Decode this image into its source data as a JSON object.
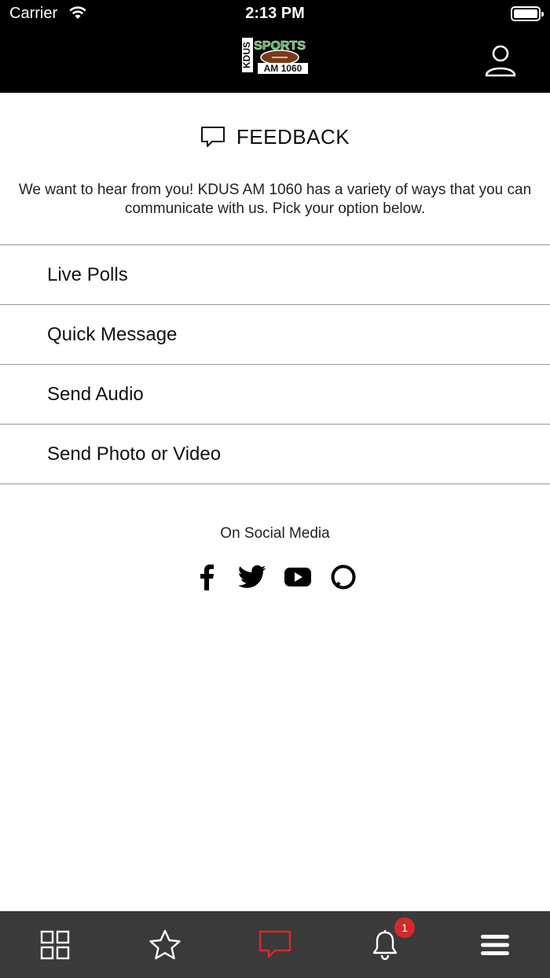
{
  "status_bar": {
    "carrier": "Carrier",
    "time": "2:13 PM"
  },
  "header": {
    "logo": {
      "line1": "KDUS",
      "line2": "SPORTS",
      "line3": "AM 1060"
    }
  },
  "feedback": {
    "title": "FEEDBACK",
    "intro": "We want to hear from you! KDUS AM 1060 has a variety of ways that you can communicate with us. Pick your option below."
  },
  "options": [
    {
      "label": "Live Polls"
    },
    {
      "label": "Quick Message"
    },
    {
      "label": "Send Audio"
    },
    {
      "label": "Send Photo or Video"
    }
  ],
  "social": {
    "label": "On Social Media",
    "icons": [
      "facebook-icon",
      "twitter-icon",
      "youtube-icon",
      "alexa-icon"
    ]
  },
  "tabbar": {
    "tabs": [
      "grid-icon",
      "star-icon",
      "chat-icon",
      "bell-icon",
      "menu-icon"
    ],
    "active_color": "#d22a2a",
    "notification_count": "1"
  }
}
